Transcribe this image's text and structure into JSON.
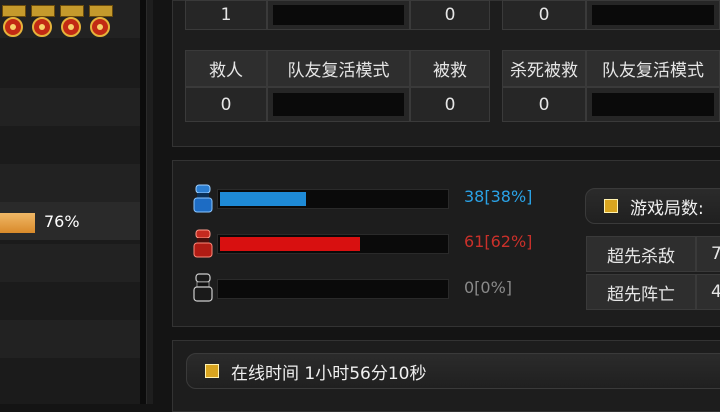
{
  "left": {
    "percent_label": "76%",
    "percent_value": 0.76
  },
  "top_row_values": [
    "1",
    "",
    "0",
    "0",
    ""
  ],
  "stats_table": {
    "headers": [
      "救人",
      "队友复活模式",
      "被救",
      "杀死被救",
      "队友复活模式"
    ],
    "values": [
      "0",
      "",
      "0",
      "0",
      ""
    ]
  },
  "team_bars": [
    {
      "label": "38[38%]",
      "ratio": 0.38,
      "color": "#1e8ad6",
      "icon": "blue-soldier-icon"
    },
    {
      "label": "61[62%]",
      "ratio": 0.62,
      "color": "#d81010",
      "icon": "red-soldier-icon"
    },
    {
      "label": "0[0%]",
      "ratio": 0.0,
      "color": "#555555",
      "icon": "gray-soldier-icon"
    }
  ],
  "team_label_colors": [
    "#2aa2e6",
    "#c9302a",
    "#8a8a8a"
  ],
  "game_rounds_label": "游戏局数:",
  "side_rows": [
    {
      "label": "超先杀敌",
      "value": "7"
    },
    {
      "label": "超先阵亡",
      "value": "4"
    }
  ],
  "online_time": "在线时间 1小时56分10秒"
}
